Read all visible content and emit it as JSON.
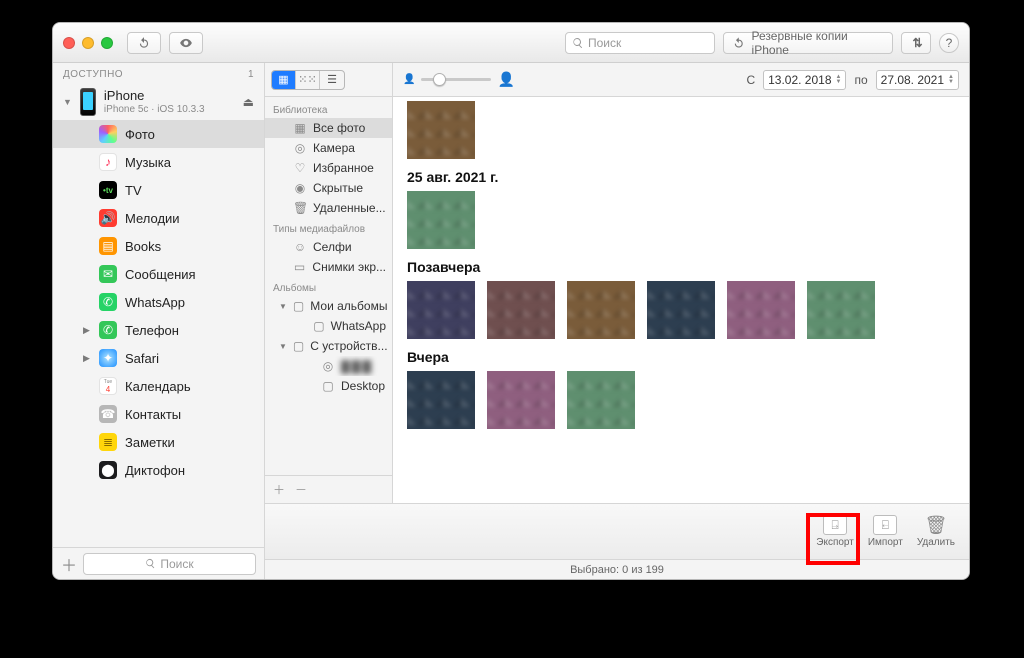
{
  "titlebar": {
    "search_placeholder": "Поиск",
    "backups_label": "Резервные копии iPhone"
  },
  "sidebar1": {
    "header": "ДОСТУПНО",
    "count": "1",
    "device": {
      "name": "iPhone",
      "sub": "iPhone 5c · iOS 10.3.3"
    },
    "items": [
      {
        "label": "Фото",
        "selected": true,
        "color": "#fff",
        "icon": "photos"
      },
      {
        "label": "Музыка",
        "color": "#fff",
        "icon": "music"
      },
      {
        "label": "TV",
        "color": "#000",
        "icon": "tv"
      },
      {
        "label": "Мелодии",
        "color": "#ff3b30",
        "icon": "ring"
      },
      {
        "label": "Books",
        "color": "#ff9500",
        "icon": "books"
      },
      {
        "label": "Сообщения",
        "color": "#34c759",
        "icon": "msg"
      },
      {
        "label": "WhatsApp",
        "color": "#25d366",
        "icon": "wa"
      },
      {
        "label": "Телефон",
        "color": "#34c759",
        "icon": "phone",
        "expander": true
      },
      {
        "label": "Safari",
        "color": "#1e90ff",
        "icon": "safari",
        "expander": true
      },
      {
        "label": "Календарь",
        "color": "#fff",
        "icon": "cal"
      },
      {
        "label": "Контакты",
        "color": "#a2a2a2",
        "icon": "contacts"
      },
      {
        "label": "Заметки",
        "color": "#ffd60a",
        "icon": "notes"
      },
      {
        "label": "Диктофон",
        "color": "#1c1c1e",
        "icon": "voice"
      }
    ],
    "footer_search_placeholder": "Поиск"
  },
  "sidebar2": {
    "groups": [
      {
        "header": "Библиотека",
        "items": [
          {
            "label": "Все фото",
            "icon": "grid",
            "selected": true
          },
          {
            "label": "Камера",
            "icon": "camera"
          },
          {
            "label": "Избранное",
            "icon": "heart"
          },
          {
            "label": "Скрытые",
            "icon": "eye"
          },
          {
            "label": "Удаленные...",
            "icon": "trash"
          }
        ]
      },
      {
        "header": "Типы медиафайлов",
        "items": [
          {
            "label": "Селфи",
            "icon": "face"
          },
          {
            "label": "Снимки экр...",
            "icon": "device"
          }
        ]
      },
      {
        "header": "Альбомы",
        "items": [
          {
            "label": "Мои альбомы",
            "icon": "folder",
            "tri": "▼"
          },
          {
            "label": "WhatsApp",
            "icon": "folder",
            "indent": true
          },
          {
            "label": "С устройств...",
            "icon": "folder",
            "tri": "▼"
          },
          {
            "label": "",
            "icon": "camera2",
            "indent": true,
            "blurred": true
          },
          {
            "label": "Desktop",
            "icon": "folder",
            "indent": true
          }
        ]
      }
    ]
  },
  "main_toolbar": {
    "from_label": "С",
    "from_date": "13.02. 2018",
    "to_label": "по",
    "to_date": "27.08. 2021"
  },
  "content": {
    "sections": [
      {
        "title": "",
        "thumbs": 1
      },
      {
        "title": "25 авг. 2021 г.",
        "thumbs": 1
      },
      {
        "title": "Позавчера",
        "thumbs": 6
      },
      {
        "title": "Вчера",
        "thumbs": 3
      }
    ]
  },
  "footer": {
    "export": "Экспорт",
    "import": "Импорт",
    "delete": "Удалить"
  },
  "statusbar": "Выбрано: 0 из 199"
}
